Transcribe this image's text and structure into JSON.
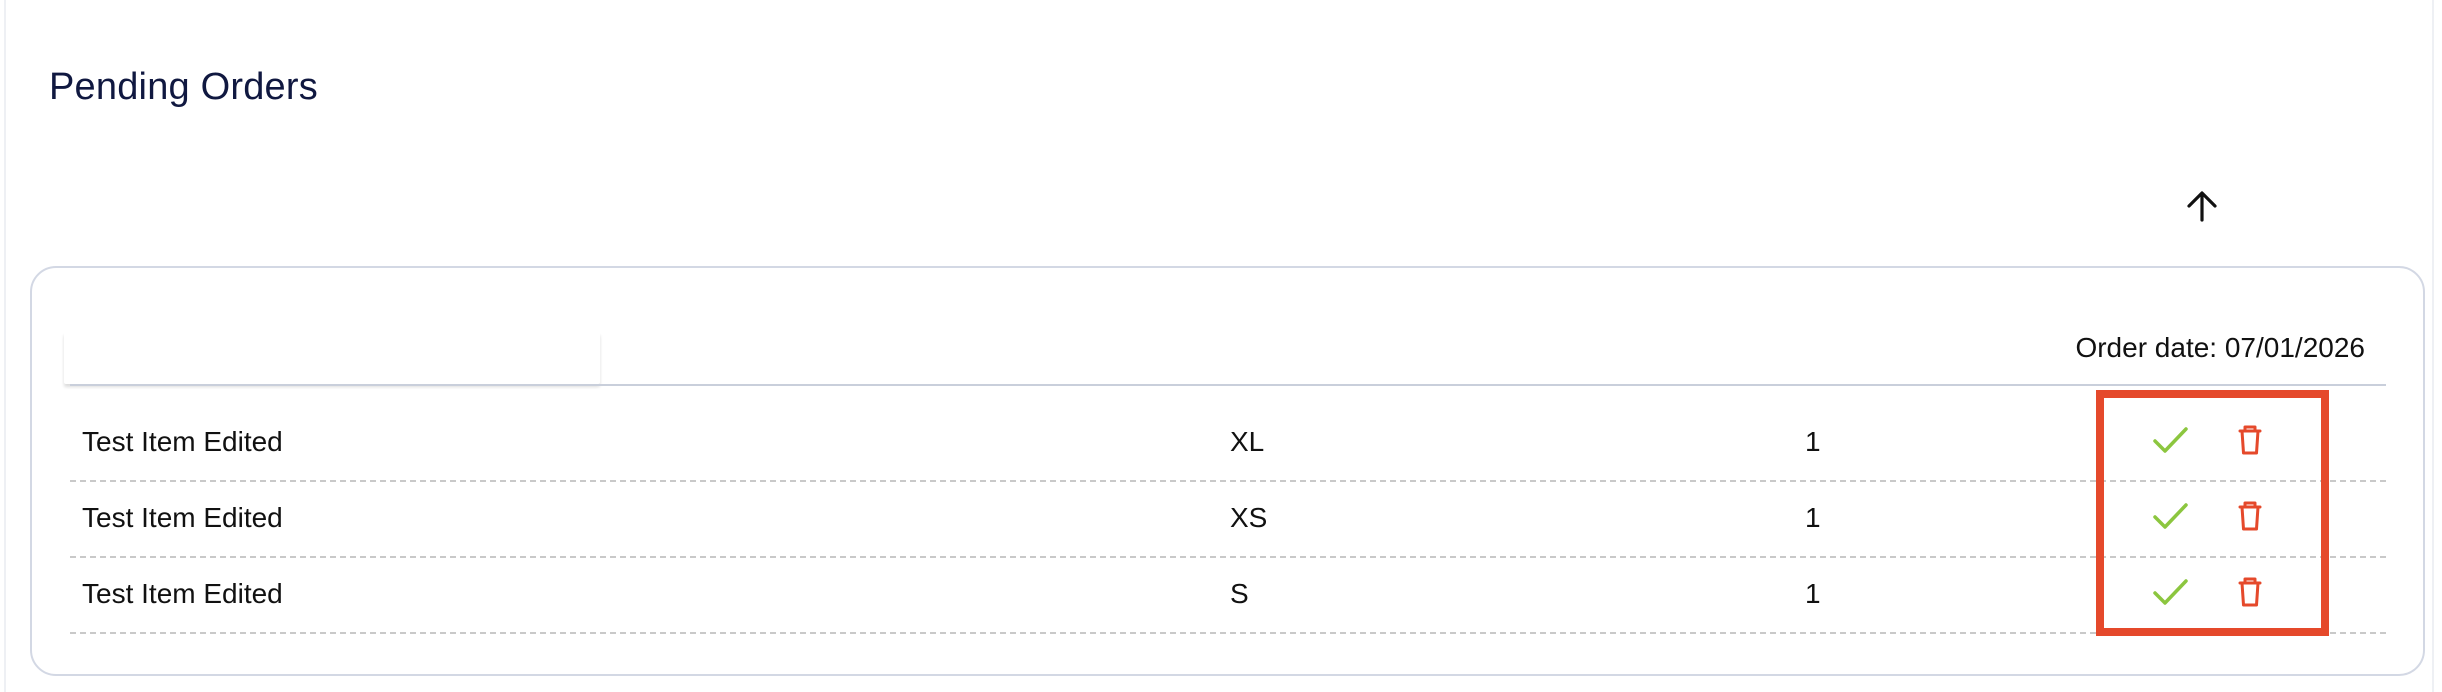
{
  "header": {
    "title": "Pending Orders",
    "sort_icon": "arrow-up-icon"
  },
  "order": {
    "date_text": "Order date: 07/01/2026",
    "items": [
      {
        "name": "Test Item Edited",
        "size": "XL",
        "quantity": "1"
      },
      {
        "name": "Test Item Edited",
        "size": "XS",
        "quantity": "1"
      },
      {
        "name": "Test Item Edited",
        "size": "S",
        "quantity": "1"
      }
    ],
    "actions": {
      "approve_icon": "check-icon",
      "delete_icon": "trash-icon"
    }
  },
  "colors": {
    "title": "#101840",
    "approve": "#8cc63f",
    "delete": "#e5492b",
    "highlight": "#e5492b",
    "card_border": "#d3d8e4"
  }
}
